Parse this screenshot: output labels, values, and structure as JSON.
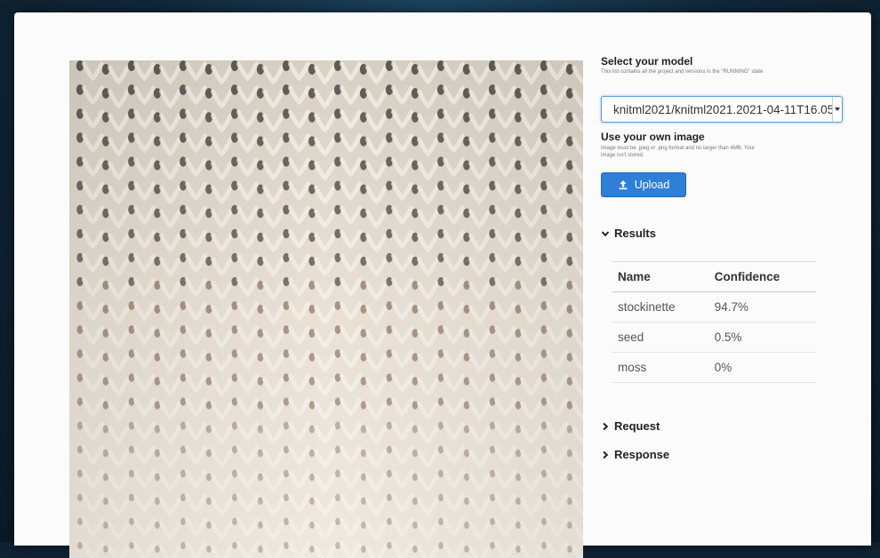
{
  "model_section": {
    "title": "Select your model",
    "description": "This list contains all the project and versions in the \"RUNNING\" state",
    "selected_model": "knitml2021/knitml2021.2021-04-11T16.05"
  },
  "image_section": {
    "title": "Use your own image",
    "description": "Image must be .jpeg or .png format and no larger than 4MB. Your image isn't stored.",
    "upload_label": "Upload",
    "upload_icon": "upload-icon"
  },
  "results": {
    "title": "Results",
    "columns": [
      "Name",
      "Confidence"
    ],
    "rows": [
      {
        "name": "stockinette",
        "confidence": "94.7%"
      },
      {
        "name": "seed",
        "confidence": "0.5%"
      },
      {
        "name": "moss",
        "confidence": "0%"
      }
    ]
  },
  "request": {
    "title": "Request"
  },
  "response": {
    "title": "Response"
  },
  "colors": {
    "accent": "#2f7ed8",
    "background": "#0f2233",
    "panel": "#fbfbfb"
  }
}
